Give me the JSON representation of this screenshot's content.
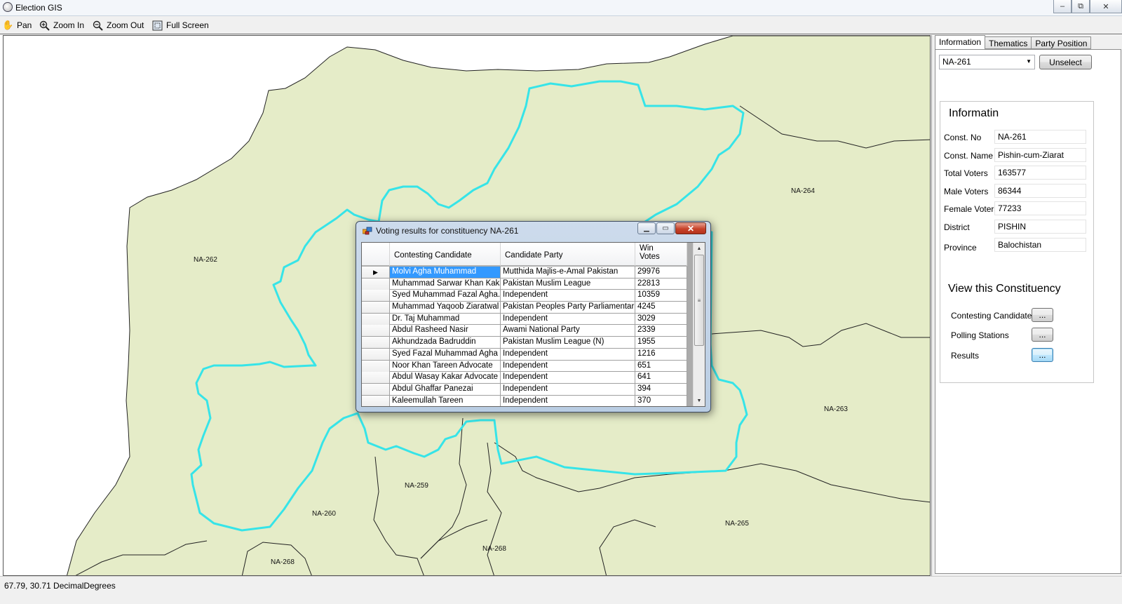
{
  "window": {
    "title": "Election GIS",
    "buttons": {
      "minimize": "–",
      "maximize": "⧉",
      "close": "✕"
    }
  },
  "toolbar": {
    "items": [
      {
        "label": "Pan",
        "icon": "hand-icon"
      },
      {
        "label": "Zoom In",
        "icon": "zoom-in-icon"
      },
      {
        "label": "Zoom Out",
        "icon": "zoom-out-icon"
      },
      {
        "label": "Full Screen",
        "icon": "full-screen-icon"
      }
    ]
  },
  "map": {
    "labels": [
      "NA-262",
      "NA-264",
      "NA-263",
      "NA-259",
      "NA-260",
      "NA-265",
      "NA-268",
      "NA-268"
    ],
    "colors": {
      "land": "#e5ecc8",
      "border": "#000000",
      "highlight": "#36e4e8"
    }
  },
  "statusbar": {
    "coords": "67.79, 30.71  DecimalDegrees"
  },
  "panel": {
    "tabs": [
      "Information",
      "Thematics",
      "Party Position"
    ],
    "active_tab": "Information",
    "constituency_select": "NA-261",
    "unselect_label": "Unselect",
    "group_title": "Informatin",
    "fields": [
      {
        "label": "Const. No",
        "value": "NA-261"
      },
      {
        "label": "Const. Name",
        "value": "Pishin-cum-Ziarat"
      },
      {
        "label": "Total Voters",
        "value": "163577"
      },
      {
        "label": "Male Voters",
        "value": "86344"
      },
      {
        "label": "Female Voters",
        "value": "77233"
      },
      {
        "label": "District",
        "value": "PISHIN"
      },
      {
        "label": "Province",
        "value": "Balochistan"
      }
    ],
    "view_title": "View this Constituency",
    "view_items": [
      {
        "label": "Contesting Candidates",
        "button": "..."
      },
      {
        "label": "Polling Stations",
        "button": "..."
      },
      {
        "label": "Results",
        "button": "..."
      }
    ]
  },
  "dialog": {
    "title": "Voting results for constituency NA-261",
    "columns": [
      "Contesting Candidate",
      "Candidate Party",
      "Win\nVotes"
    ],
    "rows": [
      [
        "Molvi Agha Muhammad",
        "Mutthida Majlis-e-Amal Pakistan",
        "29976"
      ],
      [
        "Muhammad Sarwar Khan Kakar",
        "Pakistan Muslim League",
        "22813"
      ],
      [
        "Syed Muhammad Fazal Agha.",
        "Independent",
        "10359"
      ],
      [
        "Muhammad Yaqoob Ziaratwal",
        "Pakistan Peoples Party Parliamentarians",
        "4245"
      ],
      [
        "Dr. Taj Muhammad",
        "Independent",
        "3029"
      ],
      [
        "Abdul Rasheed Nasir",
        "Awami National Party",
        "2339"
      ],
      [
        "Akhundzada Badruddin",
        "Pakistan Muslim League (N)",
        "1955"
      ],
      [
        "Syed Fazal Muhammad Agha",
        "Independent",
        "1216"
      ],
      [
        "Noor Khan Tareen Advocate",
        "Independent",
        "651"
      ],
      [
        "Abdul Wasay Kakar Advocate",
        "Independent",
        "641"
      ],
      [
        "Abdul Ghaffar Panezai",
        "Independent",
        "394"
      ],
      [
        "Kaleemullah Tareen",
        "Independent",
        "370"
      ]
    ],
    "selected_row": 0
  }
}
